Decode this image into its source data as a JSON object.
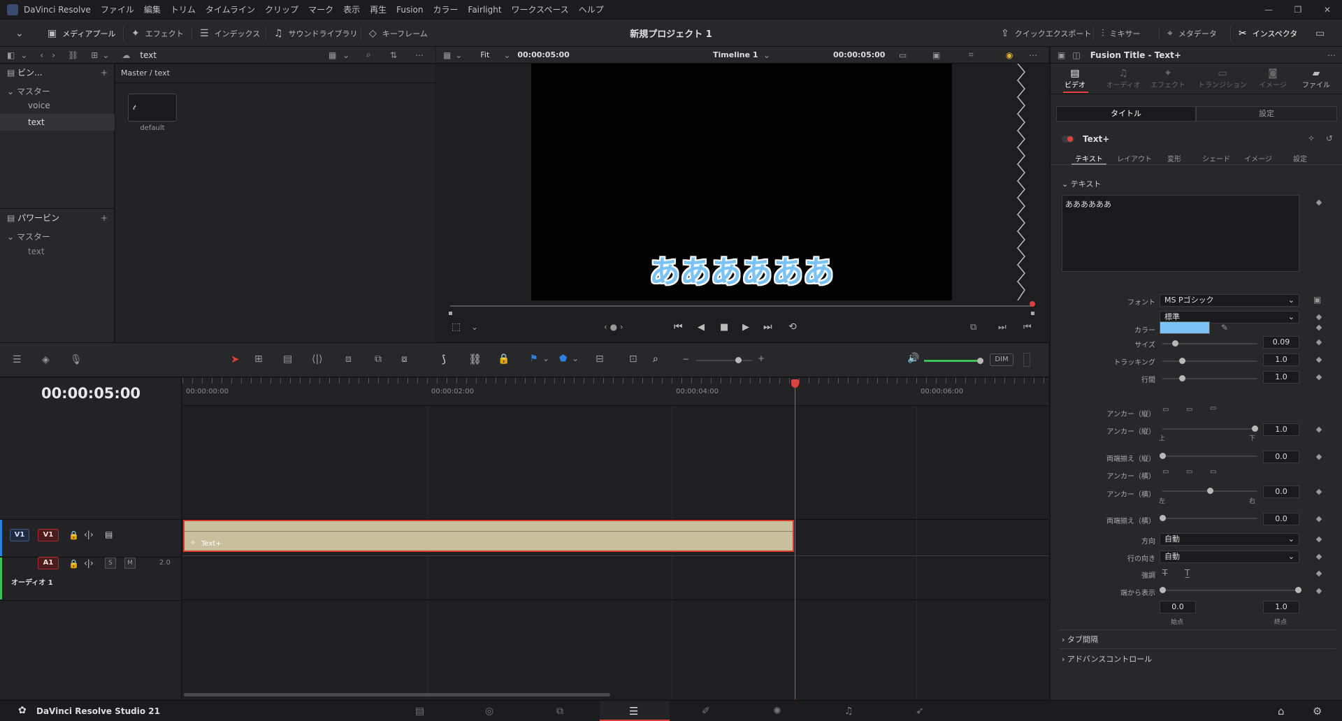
{
  "app": {
    "name": "DaVinci Resolve",
    "studio_label": "DaVinci Resolve Studio 21"
  },
  "menu": [
    "ファイル",
    "編集",
    "トリム",
    "タイムライン",
    "クリップ",
    "マーク",
    "表示",
    "再生",
    "Fusion",
    "カラー",
    "Fairlight",
    "ワークスペース",
    "ヘルプ"
  ],
  "toolbar": {
    "media_pool": "メディアプール",
    "effects": "エフェクト",
    "index": "インデックス",
    "sound_library": "サウンドライブラリ",
    "keyframes": "キーフレーム",
    "project_title": "新規プロジェクト 1",
    "quick_export": "クイックエクスポート",
    "mixer": "ミキサー",
    "metadata": "メタデータ",
    "inspector": "インスペクタ"
  },
  "mediapool": {
    "bin_name": "text",
    "path": "Master / text",
    "clip_label": "default"
  },
  "bins": {
    "header": "ビン...",
    "master": "マスター",
    "items": [
      "voice",
      "text"
    ],
    "power_bins": "パワービン",
    "power_master": "マスター",
    "power_item": "text"
  },
  "viewer": {
    "zoom": "Fit",
    "timecode_left": "00:00:05:00",
    "timeline_name": "Timeline 1",
    "timecode_right": "00:00:05:00",
    "subtitle_text": "ああああああ"
  },
  "timeline": {
    "timecode": "00:00:05:00",
    "ruler": [
      "00:00:00:00",
      "00:00:02:00",
      "00:00:04:00",
      "00:00:06:00"
    ],
    "v1": "V1",
    "a1": "A1",
    "a1_level": "2.0",
    "audio_name": "オーディオ 1",
    "clip_name": "Text+",
    "dim": "DIM",
    "solo": "S",
    "mute": "M"
  },
  "inspector": {
    "title": "Fusion Title - Text+",
    "tabs": [
      "ビデオ",
      "オーディオ",
      "エフェクト",
      "トランジション",
      "イメージ",
      "ファイル"
    ],
    "subtabs": [
      "タイトル",
      "設定"
    ],
    "node": "Text+",
    "texttabs": [
      "テキスト",
      "レイアウト",
      "変形",
      "シェード",
      "イメージ",
      "設定"
    ],
    "section_text": "テキスト",
    "text_value": "ああああああ",
    "font_label": "フォント",
    "font_value": "MS Pゴシック",
    "style_value": "標準",
    "color_label": "カラー",
    "color_hex": "#7cc3f5",
    "size_label": "サイズ",
    "size_value": "0.09",
    "tracking_label": "トラッキング",
    "tracking_value": "1.0",
    "linespacing_label": "行間",
    "linespacing_value": "1.0",
    "anchor_v_label": "アンカー（縦）",
    "anchor_v2_label": "アンカー（縦）",
    "anchor_v_value": "1.0",
    "top_label": "上",
    "bottom_label": "下",
    "justify_v_label": "両端揃え（縦）",
    "justify_v_value": "0.0",
    "anchor_h_label": "アンカー（横）",
    "anchor_h2_label": "アンカー（横）",
    "anchor_h_value": "0.0",
    "left_label": "左",
    "right_label": "右",
    "justify_h_label": "両端揃え（横）",
    "justify_h_value": "0.0",
    "direction_label": "方向",
    "direction_value": "自動",
    "line_dir_label": "行の向き",
    "line_dir_value": "自動",
    "emphasis_label": "強調",
    "write_label": "端から表示",
    "start_value": "0.0",
    "end_value": "1.0",
    "start_label": "始点",
    "end_label": "終点",
    "tab_spacing": "タブ間隔",
    "advanced": "アドバンスコントロール"
  }
}
